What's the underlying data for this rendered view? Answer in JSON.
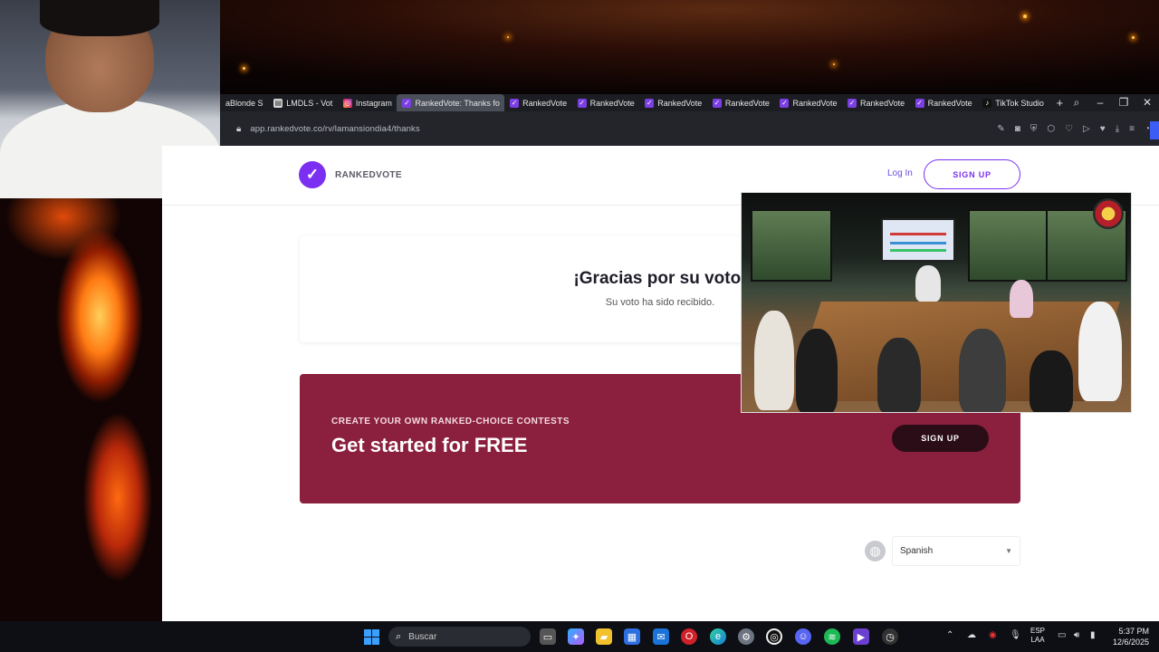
{
  "browser": {
    "tabs": [
      {
        "label": "aBlonde S",
        "icon": "none",
        "active": false
      },
      {
        "label": "LMDLS - Vot",
        "icon": "doc",
        "active": false
      },
      {
        "label": "Instagram",
        "icon": "instagram",
        "active": false
      },
      {
        "label": "RankedVote: Thanks fo",
        "icon": "rankedvote",
        "active": true
      },
      {
        "label": "RankedVote",
        "icon": "rankedvote",
        "active": false
      },
      {
        "label": "RankedVote",
        "icon": "rankedvote",
        "active": false
      },
      {
        "label": "RankedVote",
        "icon": "rankedvote",
        "active": false
      },
      {
        "label": "RankedVote",
        "icon": "rankedvote",
        "active": false
      },
      {
        "label": "RankedVote",
        "icon": "rankedvote",
        "active": false
      },
      {
        "label": "RankedVote",
        "icon": "rankedvote",
        "active": false
      },
      {
        "label": "RankedVote",
        "icon": "rankedvote",
        "active": false
      },
      {
        "label": "TikTok Studio",
        "icon": "tiktok",
        "active": false
      }
    ],
    "url": "app.rankedvote.co/rv/lamansiondia4/thanks"
  },
  "nav": {
    "logo_text": "RANKEDVOTE",
    "logo_glyph": "✓",
    "login_label": "Log In",
    "signup_label": "SIGN UP"
  },
  "thanks": {
    "title": "¡Gracias por su voto!",
    "subtitle": "Su voto ha sido recibido."
  },
  "promo": {
    "eyebrow": "CREATE YOUR OWN RANKED-CHOICE CONTESTS",
    "title": "Get started for FREE",
    "button_label": "SIGN UP"
  },
  "language": {
    "selected": "Spanish"
  },
  "taskbar": {
    "search_placeholder": "Buscar",
    "lang_line1": "ESP",
    "lang_line2": "LAA",
    "time": "5:37 PM",
    "date": "12/6/2025"
  },
  "colors": {
    "brand_purple": "#7b2ff0",
    "promo_bg": "#8b1f3e",
    "promo_button": "#2b0d18"
  }
}
